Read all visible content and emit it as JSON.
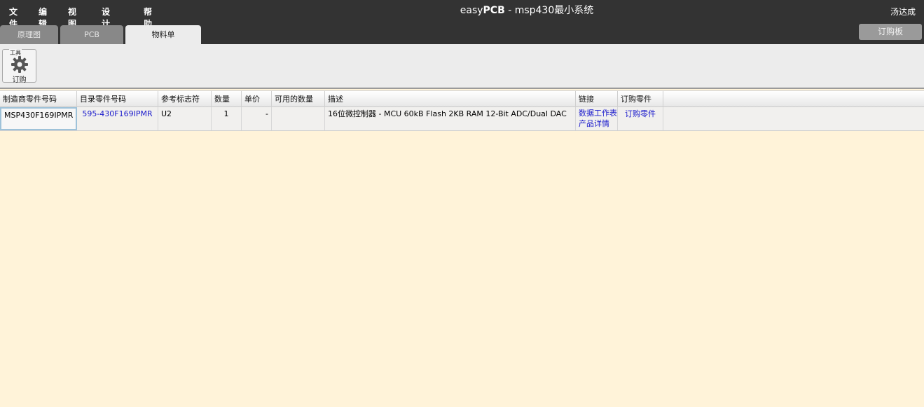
{
  "menu": {
    "file": "文件",
    "edit": "编辑",
    "view": "视图",
    "design": "设计",
    "help": "帮助"
  },
  "window_title": {
    "prefix": "easy",
    "brand": "PCB",
    "suffix": " - msp430最小系统"
  },
  "user": "汤达成",
  "tabs": [
    {
      "label": "原理图",
      "state": "inactive"
    },
    {
      "label": "PCB",
      "state": "inactive"
    },
    {
      "label": "物料单",
      "state": "active"
    }
  ],
  "order_board_button": "订购板",
  "toolbar": {
    "group_label": "工具",
    "order_button": {
      "label": "订购",
      "icon": "gear-icon"
    }
  },
  "table": {
    "columns": [
      "制造商零件号码",
      "目录零件号码",
      "参考标志符",
      "数量",
      "单价",
      "可用的数量",
      "描述",
      "链接",
      "订购零件"
    ],
    "rows": [
      {
        "mfr_part": "MSP430F169IPMR",
        "catalog_part": "595-430F169IPMR",
        "reference": "U2",
        "quantity": "1",
        "unit_price": "-",
        "available": "",
        "description": "16位微控制器 - MCU 60kB Flash 2KB RAM 12-Bit ADC/Dual DAC",
        "links": [
          "数据工作表",
          "产品详情"
        ],
        "order": "订购零件"
      }
    ]
  },
  "colors": {
    "topbar": "#333333",
    "toolbar": "#ececec",
    "workspace": "#fff3d9",
    "link": "#1a1acc"
  }
}
